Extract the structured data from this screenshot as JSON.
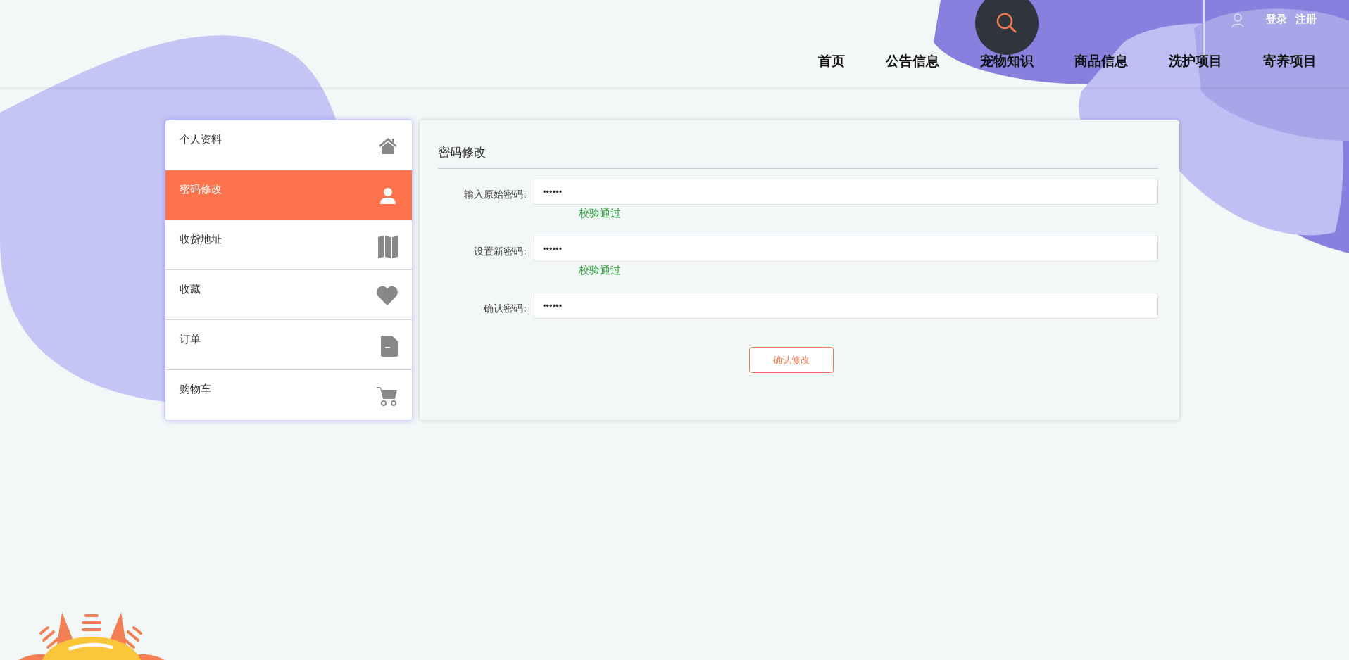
{
  "header": {
    "auth_links": [
      "登录",
      "注册"
    ],
    "nav": [
      "首页",
      "公告信息",
      "宠物知识",
      "商品信息",
      "洗护项目",
      "寄养项目"
    ]
  },
  "sidebar": {
    "items": [
      {
        "label": "个人资料",
        "kind": "home",
        "selected": false
      },
      {
        "label": "密码修改",
        "kind": "user",
        "selected": true
      },
      {
        "label": "收货地址",
        "kind": "map",
        "selected": false
      },
      {
        "label": "收藏",
        "kind": "heart",
        "selected": false
      },
      {
        "label": "订单",
        "kind": "file",
        "selected": false
      },
      {
        "label": "购物车",
        "kind": "cart",
        "selected": false
      }
    ]
  },
  "panel": {
    "title": "密码修改",
    "fields": [
      {
        "label": "输入原始密码:",
        "value": "••••••",
        "validation": "校验通过"
      },
      {
        "label": "设置新密码:",
        "value": "••••••",
        "validation": "校验通过"
      },
      {
        "label": "确认密码:",
        "value": "••••••"
      }
    ],
    "submit": "确认修改"
  }
}
